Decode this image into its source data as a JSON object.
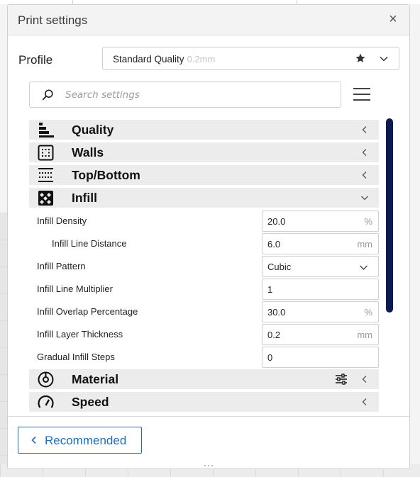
{
  "window": {
    "title": "Print settings",
    "close_symbol": "×"
  },
  "profile": {
    "label": "Profile",
    "name": "Standard Quality",
    "layer_height": "0.2mm"
  },
  "search": {
    "placeholder": "Search settings"
  },
  "categories": {
    "quality": {
      "label": "Quality",
      "icon": "quality-icon",
      "expanded": false
    },
    "walls": {
      "label": "Walls",
      "icon": "walls-icon",
      "expanded": false
    },
    "top_bottom": {
      "label": "Top/Bottom",
      "icon": "top-bottom-icon",
      "expanded": false
    },
    "infill": {
      "label": "Infill",
      "icon": "infill-icon",
      "expanded": true
    },
    "material": {
      "label": "Material",
      "icon": "material-icon",
      "expanded": false
    },
    "speed": {
      "label": "Speed",
      "icon": "speed-icon",
      "expanded": false
    }
  },
  "infill_settings": [
    {
      "label": "Infill Density",
      "value": "20.0",
      "unit": "%"
    },
    {
      "label": "Infill Line Distance",
      "value": "6.0",
      "unit": "mm"
    },
    {
      "label": "Infill Pattern",
      "value": "Cubic",
      "unit": ""
    },
    {
      "label": "Infill Line Multiplier",
      "value": "1",
      "unit": ""
    },
    {
      "label": "Infill Overlap Percentage",
      "value": "30.0",
      "unit": "%"
    },
    {
      "label": "Infill Layer Thickness",
      "value": "0.2",
      "unit": "mm"
    },
    {
      "label": "Gradual Infill Steps",
      "value": "0",
      "unit": ""
    }
  ],
  "footer": {
    "recommended_label": "Recommended"
  },
  "colors": {
    "accent": "#1e6fb8",
    "scrollbar": "#0b1a4f",
    "category_bg": "#ececec"
  }
}
